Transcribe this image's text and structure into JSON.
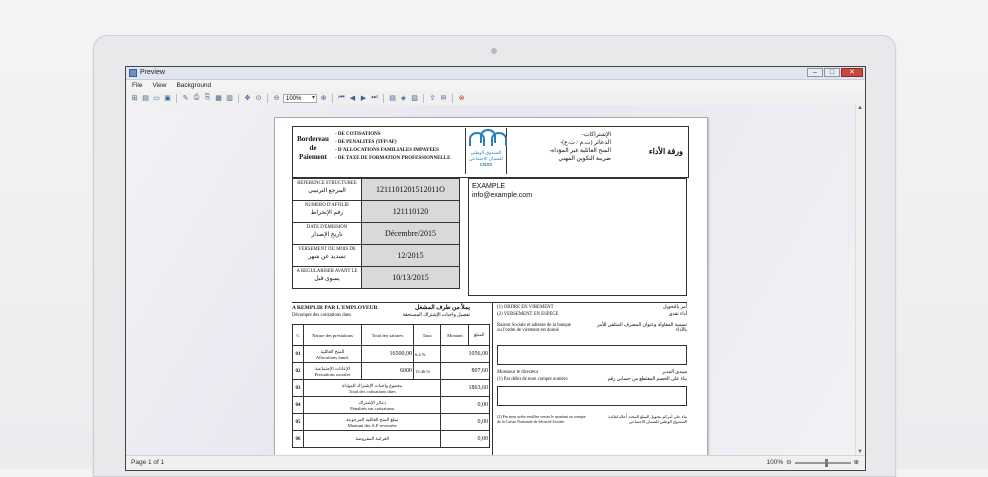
{
  "window": {
    "title": "Preview",
    "btn_min": "–",
    "btn_max": "□",
    "btn_close": "✕"
  },
  "menu": {
    "items": [
      "File",
      "View",
      "Background"
    ]
  },
  "toolbar": {
    "zoom": "100%"
  },
  "statusbar": {
    "page_info": "Page 1 of 1",
    "zoom": "100%",
    "zoom_out": "⊖",
    "zoom_in": "⊕"
  },
  "document": {
    "bordereau": "Bordereau de Paiement",
    "header_items": [
      "- DE COTISATIONS",
      "- DE PENALITES (TFP/AF)",
      "- D'ALLOCATIONS FAMILIALES IMPAYEES",
      "- DE TAXE DE FORMATION PROFESSIONNELLE"
    ],
    "logo_text": "الصندوق الوطني للضمان الاجتماعي",
    "logo_code": "CNSS",
    "header_ar": [
      "-الإشتراكات",
      "-الذعائر (ت.م / ت.ع)",
      "-المنح العائلية غير المؤداة",
      "ضريبة التكوين المهني"
    ],
    "title_ar": "ورقة الأداء",
    "refs": [
      {
        "label": "REFERENCE STRUCTUREE",
        "label_ar": "المرجع الترتيبي",
        "value": "1211101201512011O"
      },
      {
        "label": "NUMERO D'AFFILIE",
        "label_ar": "رقم الإنخراط",
        "value": "121110120"
      },
      {
        "label": "DATE D'EMISSION",
        "label_ar": "تاريخ الإصدار",
        "value": "Décembre/2015"
      },
      {
        "label": "VERSEMENT DU MOIS DE",
        "label_ar": "تسديد عن شهر",
        "value": "12/2015"
      },
      {
        "label": "A REGULARISER AVANT LE",
        "label_ar": "يسوى قبل",
        "value": "10/13/2015"
      }
    ],
    "address": {
      "name": "EXAMPLE",
      "email": "info@example.com"
    },
    "employer": {
      "title": "A REMPLIR PAR L'EMPLOYEUR",
      "title_ar": "يملأ من طرف المشغل",
      "subtitle": "Décompte des cotisations dues",
      "subtitle_ar": "تفصيل واجبات الإشتراك المستحقة",
      "columns": [
        "C",
        "Nature des prestations",
        "Total des salaires",
        "Taux",
        "Montant",
        "المبلغ"
      ],
      "rows": [
        {
          "code": "01",
          "label": "Allocations famil.",
          "label_ar": "المنح العائلية",
          "base": "16500,00",
          "rate": "6,4 %",
          "amount": "1056,00"
        },
        {
          "code": "02",
          "label": "Prestations sociales",
          "label_ar": "الإعانات الإجتماعية",
          "base": "6000",
          "rate": "13,46 %",
          "amount": "807,60"
        },
        {
          "code": "03",
          "label": "Total des cotisations dues",
          "label_ar": "مجموع واجبات الإشتراك المؤداة",
          "base": "",
          "rate": "",
          "amount": "1863,60"
        },
        {
          "code": "04",
          "label": "Pénalités sur cotisations",
          "label_ar": "ذعائر الإشتراك",
          "base": "",
          "rate": "",
          "amount": "0,00"
        },
        {
          "code": "05",
          "label": "Montant des A.F reversées",
          "label_ar": "مبلغ المنح العائلية المرجوعة",
          "base": "",
          "rate": "",
          "amount": "0,00"
        },
        {
          "code": "06",
          "label": "",
          "label_ar": "الغرامة المفروضة",
          "base": "",
          "rate": "",
          "amount": "0,00"
        }
      ]
    },
    "right": {
      "ordre": "(1) ORDRE EN VIREMENT",
      "ordre_ar": "أمر بالتحويل",
      "versement": "(2) VERSEMENT EN ESPECE",
      "versement_ar": "أداء نقدي",
      "bank": "Raison Sociale et adresse de la banque ou l'ordre de virement est donné",
      "bank_ar": "تسمية المقاولة وعنوان المصرف المتلقي للأمر بالأداء",
      "director": "Monsieur le directeur",
      "director_ar": "سيدي المدير",
      "debit": "(1) Par débit de mon compte numéro",
      "debit_ar": "بناء على الخصم المقتطع من حسابي رقم",
      "footer": "(2) Par mon ordre veuillez verser le montant au compte de la Caisse Nationale de Sécurité Sociale",
      "footer_ar": "بناء على أمركم بتحويل المبلغ المحدد أعلاه لفائدة الصندوق الوطني للضمان الاجتماعي"
    }
  }
}
